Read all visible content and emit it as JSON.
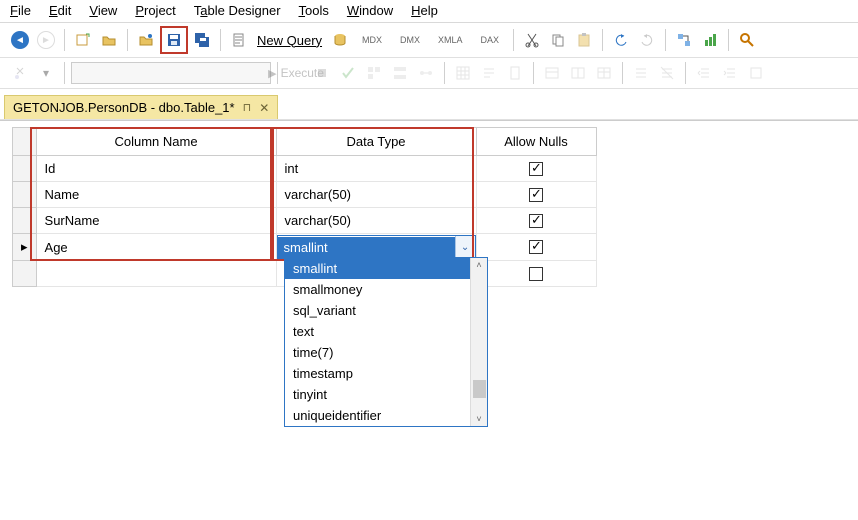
{
  "menu": {
    "file": "File",
    "edit": "Edit",
    "view": "View",
    "project": "Project",
    "table_designer": "Table Designer",
    "tools": "Tools",
    "window": "Window",
    "help": "Help"
  },
  "toolbar": {
    "new_query": "New Query",
    "mdx": "MDX",
    "dmx": "DMX",
    "xmla": "XMLA",
    "dax": "DAX",
    "execute": "Execute"
  },
  "tab": {
    "title": "GETONJOB.PersonDB - dbo.Table_1*"
  },
  "headers": {
    "column_name": "Column Name",
    "data_type": "Data Type",
    "allow_nulls": "Allow Nulls"
  },
  "rows": [
    {
      "name": "Id",
      "type": "int",
      "nulls": true
    },
    {
      "name": "Name",
      "type": "varchar(50)",
      "nulls": true
    },
    {
      "name": "SurName",
      "type": "varchar(50)",
      "nulls": true
    },
    {
      "name": "Age",
      "type": "smallint",
      "nulls": true,
      "editing": true
    }
  ],
  "empty_row": {
    "name": "",
    "type": "",
    "nulls": false
  },
  "dropdown": {
    "options": [
      "smallint",
      "smallmoney",
      "sql_variant",
      "text",
      "time(7)",
      "timestamp",
      "tinyint",
      "uniqueidentifier"
    ],
    "selected_index": 0
  }
}
